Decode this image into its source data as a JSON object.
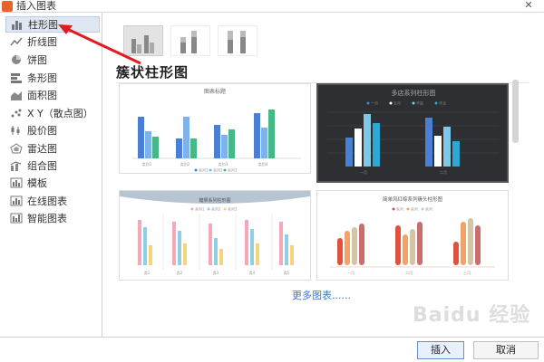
{
  "window": {
    "title": "插入图表",
    "close_glyph": "✕"
  },
  "sidebar": {
    "items": [
      {
        "label": "柱形图",
        "icon": "column-chart-icon",
        "active": true
      },
      {
        "label": "折线图",
        "icon": "line-chart-icon"
      },
      {
        "label": "饼图",
        "icon": "pie-chart-icon"
      },
      {
        "label": "条形图",
        "icon": "bar-chart-icon"
      },
      {
        "label": "面积图",
        "icon": "area-chart-icon"
      },
      {
        "label": "X Y（散点图）",
        "icon": "scatter-chart-icon"
      },
      {
        "label": "股价图",
        "icon": "stock-chart-icon"
      },
      {
        "label": "雷达图",
        "icon": "radar-chart-icon"
      },
      {
        "label": "组合图",
        "icon": "combo-chart-icon"
      },
      {
        "label": "模板",
        "icon": "template-icon"
      },
      {
        "label": "在线图表",
        "icon": "online-chart-icon"
      },
      {
        "label": "智能图表",
        "icon": "smart-chart-icon"
      }
    ]
  },
  "subtypes": [
    "clustered-column",
    "stacked-column",
    "percent-stacked-column"
  ],
  "section_title": "簇状柱形图",
  "thumbnails": [
    {
      "title": "图表标题",
      "style": "light",
      "legend": [
        "系列1",
        "系列2",
        "系列3"
      ],
      "categories": [
        "类别1",
        "类别2",
        "类别3",
        "类别4"
      ]
    },
    {
      "title": "多店系列柱形图",
      "style": "dark",
      "legend": [
        "一月",
        "五月",
        "华南",
        "华北"
      ],
      "categories": [
        "一月",
        "二月"
      ]
    },
    {
      "title": "糖果系列柱形图",
      "style": "pastel",
      "legend": [
        "系列1",
        "系列2",
        "系列3"
      ],
      "categories": [
        "类1",
        "类2",
        "类3",
        "类4",
        "类5"
      ]
    },
    {
      "title": "简单风红棕系列簇头柱形图",
      "style": "warm",
      "legend": [
        "系列",
        "系列",
        "系列"
      ],
      "categories": [
        "一月",
        "二月",
        "三月"
      ]
    }
  ],
  "more_link": "更多图表......",
  "buttons": {
    "insert": "插入",
    "cancel": "取消"
  },
  "watermark": "Baidu 经验",
  "colors": {
    "accent_blue": "#3a7bd5",
    "arrow_red": "#e11b22"
  }
}
